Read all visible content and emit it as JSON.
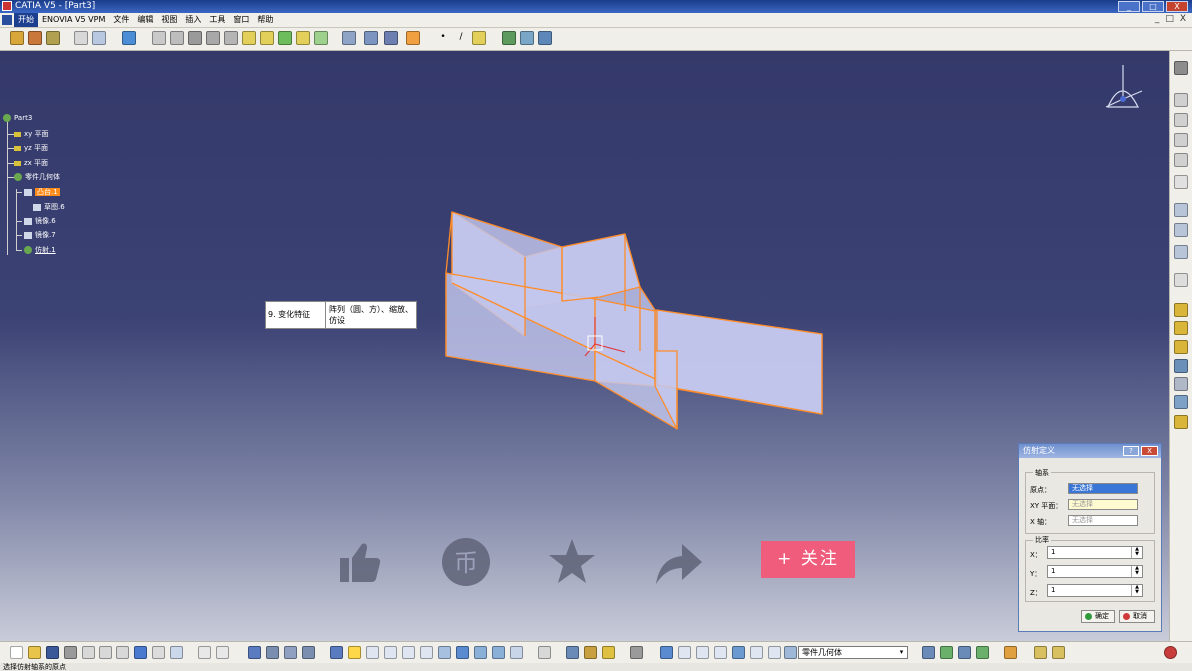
{
  "window": {
    "title": "CATIA V5 - [Part3]",
    "controls": [
      "_",
      "□",
      "X"
    ]
  },
  "menubar": {
    "items": [
      "开始",
      "ENOVIA V5 VPM",
      "文件",
      "编辑",
      "视图",
      "插入",
      "工具",
      "窗口",
      "帮助"
    ],
    "mdi_controls": [
      "_",
      "□",
      "X"
    ]
  },
  "tree": {
    "root": "Part3",
    "nodes": [
      "xy 平面",
      "yz 平面",
      "zx 平面",
      "零件几何体",
      "凸台.1",
      "草图.6",
      "镜像.6",
      "镜像.7",
      "仿射.1"
    ]
  },
  "annotation": {
    "label": "9. 变化特征",
    "text": "阵列（圆、方）、缩放、仿设"
  },
  "social": {
    "follow_label": "+ 关注"
  },
  "dialog": {
    "title": "仿射定义",
    "help": "?",
    "close": "X",
    "axis_group": "轴系",
    "origin_label": "原点：",
    "origin_value": "无选择",
    "xy_label": "XY 平面：",
    "xy_value": "无选择",
    "xaxis_label": "X 轴：",
    "xaxis_value": "无选择",
    "ratio_group": "比率",
    "x_label": "X：",
    "x_value": "1",
    "y_label": "Y：",
    "y_value": "1",
    "z_label": "Z：",
    "z_value": "1",
    "ok": "确定",
    "cancel": "取消"
  },
  "bottom": {
    "combo_value": "零件几何体"
  },
  "status": {
    "text": "选择仿射轴系的原点"
  },
  "colors": {
    "viewport_top": "#34396a",
    "edge": "#ff8c2a",
    "face": "#c5c8ee",
    "follow": "#f05d7c",
    "selected": "#ff8c1a"
  }
}
